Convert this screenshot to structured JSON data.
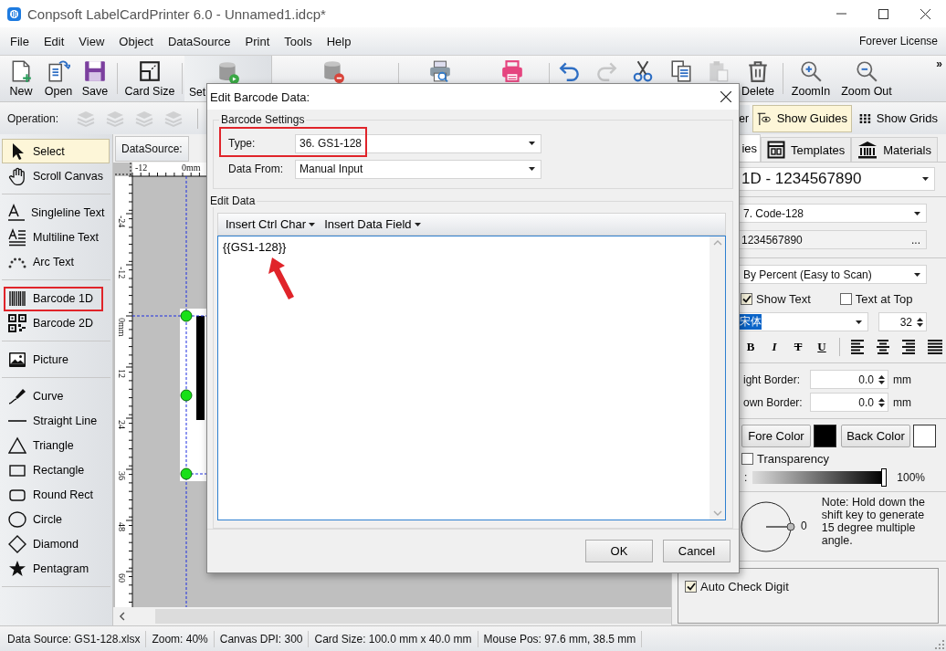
{
  "window": {
    "title": "Conpsoft LabelCardPrinter 6.0 - Unnamed1.idcp*"
  },
  "menu": {
    "items": [
      "File",
      "Edit",
      "View",
      "Object",
      "DataSource",
      "Print",
      "Tools",
      "Help"
    ],
    "license": "Forever License"
  },
  "toolbar": {
    "items": [
      {
        "kind": "button",
        "label": "New",
        "disabled": false
      },
      {
        "kind": "button",
        "label": "Open",
        "disabled": false
      },
      {
        "kind": "button",
        "label": "Save",
        "disabled": false
      },
      {
        "kind": "separator"
      },
      {
        "kind": "button",
        "label": "Card Size",
        "disabled": false
      },
      {
        "kind": "separator"
      },
      {
        "kind": "button",
        "label": "Set",
        "disabled": false
      },
      {
        "kind": "button",
        "disabled": false
      },
      {
        "kind": "separator"
      },
      {
        "kind": "button",
        "disabled": false
      },
      {
        "kind": "button",
        "disabled": false
      },
      {
        "kind": "separator"
      },
      {
        "kind": "button",
        "disabled": false
      },
      {
        "kind": "button",
        "disabled": true
      },
      {
        "kind": "button",
        "disabled": false
      },
      {
        "kind": "button",
        "disabled": false
      },
      {
        "kind": "button",
        "disabled": true
      },
      {
        "kind": "button",
        "label": "Delete",
        "disabled": false
      },
      {
        "kind": "separator"
      },
      {
        "kind": "button",
        "label": "ZoomIn",
        "disabled": false
      },
      {
        "kind": "button",
        "label": "Zoom Out",
        "disabled": false
      }
    ],
    "overflow": "»"
  },
  "operation_bar": {
    "label": "Operation:",
    "tools": [
      {
        "disabled": true
      },
      {
        "disabled": true
      },
      {
        "disabled": true
      },
      {
        "disabled": true
      }
    ],
    "toggles": [
      {
        "label": "er",
        "selected": false
      },
      {
        "label": "Show Guides",
        "selected": true
      },
      {
        "label": "Show Grids",
        "selected": false
      }
    ]
  },
  "tools": [
    {
      "kind": "tool",
      "label": "Select",
      "selected": true,
      "highlighted": false
    },
    {
      "kind": "tool",
      "label": "Scroll Canvas",
      "selected": false,
      "highlighted": false
    },
    {
      "kind": "separator"
    },
    {
      "kind": "tool",
      "label": "Singleline Text",
      "selected": false,
      "highlighted": false
    },
    {
      "kind": "tool",
      "label": "Multiline Text",
      "selected": false,
      "highlighted": false
    },
    {
      "kind": "tool",
      "label": "Arc Text",
      "selected": false,
      "highlighted": false
    },
    {
      "kind": "separator"
    },
    {
      "kind": "tool",
      "label": "Barcode 1D",
      "selected": false,
      "highlighted": true
    },
    {
      "kind": "tool",
      "label": "Barcode 2D",
      "selected": false,
      "highlighted": false
    },
    {
      "kind": "separator"
    },
    {
      "kind": "tool",
      "label": "Picture",
      "selected": false,
      "highlighted": false
    },
    {
      "kind": "separator"
    },
    {
      "kind": "tool",
      "label": "Curve",
      "selected": false,
      "highlighted": false
    },
    {
      "kind": "tool",
      "label": "Straight Line",
      "selected": false,
      "highlighted": false
    },
    {
      "kind": "tool",
      "label": "Triangle",
      "selected": false,
      "highlighted": false
    },
    {
      "kind": "tool",
      "label": "Rectangle",
      "selected": false,
      "highlighted": false
    },
    {
      "kind": "tool",
      "label": "Round Rect",
      "selected": false,
      "highlighted": false
    },
    {
      "kind": "tool",
      "label": "Circle",
      "selected": false,
      "highlighted": false
    },
    {
      "kind": "tool",
      "label": "Diamond",
      "selected": false,
      "highlighted": false
    },
    {
      "kind": "tool",
      "label": "Pentagram",
      "selected": false,
      "highlighted": false
    },
    {
      "kind": "separator"
    }
  ],
  "canvas": {
    "datasource_label": "DataSource:",
    "top_ruler": [
      "-12",
      "0mm"
    ],
    "left_ruler": [
      "-24",
      "-12",
      "0mm",
      "12",
      "24",
      "36",
      "48",
      "60"
    ]
  },
  "properties": {
    "tabs": [
      {
        "label": "ies",
        "selected": true
      },
      {
        "label": "Templates",
        "selected": false
      },
      {
        "label": "Materials",
        "selected": false
      }
    ],
    "object": "1D - 1234567890",
    "barcode_type": "7.  Code-128",
    "data": "1234567890",
    "data_button": "...",
    "size_mode": "By Percent (Easy to Scan)",
    "checks": [
      {
        "label": "Show Text",
        "checked": true
      },
      {
        "label": "Text at Top",
        "checked": false
      }
    ],
    "font": "宋体",
    "font_size": "32",
    "format": [
      "B",
      "I",
      "T",
      "U"
    ],
    "borders": [
      {
        "label": "ight Border:",
        "value": "0.0",
        "unit": "mm"
      },
      {
        "label": "own Border:",
        "value": "0.0",
        "unit": "mm"
      }
    ],
    "colors": [
      {
        "label": "Fore Color",
        "color": "#000000"
      },
      {
        "label": "Back Color",
        "color": "#ffffff"
      }
    ],
    "transparency": {
      "label": "Transparency",
      "checked": false
    },
    "opacity": {
      "label": ":",
      "level": 1,
      "reading": "100%"
    },
    "rotation": {
      "value": "0",
      "note": "Note: Hold down the shift key to generate 15 degree multiple angle."
    },
    "auto_check_digit": {
      "label": "Auto Check Digit",
      "checked": true
    }
  },
  "dialog": {
    "title": "Edit Barcode Data:",
    "barcode_settings": {
      "title": "Barcode Settings",
      "type": {
        "label": "Type:",
        "value": "36.  GS1-128",
        "highlighted": true
      },
      "data_from": {
        "label": "Data From:",
        "value": "Manual Input"
      }
    },
    "edit_data": {
      "title": "Edit Data",
      "menus": [
        "Insert Ctrl Char",
        "Insert Data Field"
      ],
      "value": "{{GS1-128}}"
    },
    "buttons": [
      "OK",
      "Cancel"
    ]
  },
  "status_bar": [
    "Data Source: GS1-128.xlsx",
    "Zoom: 40%",
    "Canvas DPI: 300",
    "Card Size: 100.0 mm x 40.0 mm",
    "Mouse Pos: 97.6 mm, 38.5 mm"
  ]
}
